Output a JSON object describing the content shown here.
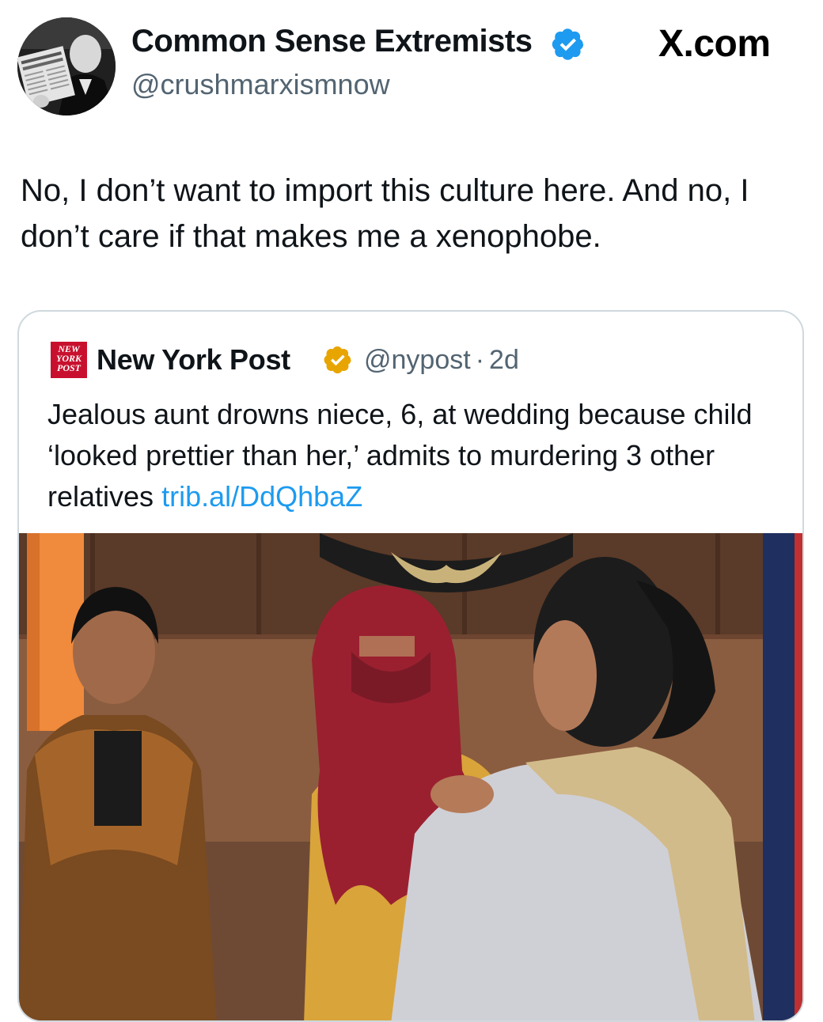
{
  "author": {
    "display_name": "Common Sense Extremists",
    "handle": "@crushmarxismnow",
    "verified_badge_color": "#1d9bf0"
  },
  "brand": {
    "label": "X.com"
  },
  "tweet": {
    "text": "No, I don’t want to import this culture here. And no, I don’t care if that makes me a xenophobe."
  },
  "quoted_tweet": {
    "logo_icon": "new-york-post-logo",
    "logo_text_lines": [
      "NEW",
      "YORK",
      "POST"
    ],
    "display_name": "New York Post",
    "verified_badge_color": "#e8a500",
    "handle": "@nypost",
    "separator": "·",
    "age": "2d",
    "text": "Jealous aunt drowns niece, 6, at wedding because child ‘looked prettier than her,’ admits to murdering 3 other relatives",
    "link": "trib.al/DdQhbaZ"
  },
  "colors": {
    "text": "#0f1419",
    "secondary_text": "#536471",
    "link": "#1d9bf0",
    "card_border": "#cfd9de",
    "nyp_red": "#c8102e"
  }
}
